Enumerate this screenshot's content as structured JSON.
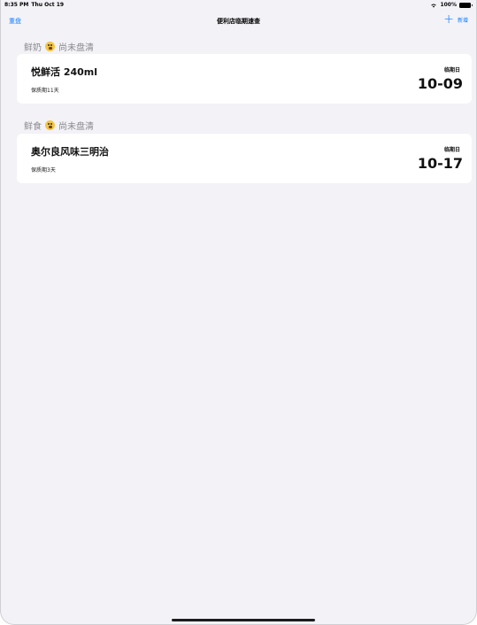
{
  "status_bar": {
    "time": "8:35 PM",
    "date": "Thu Oct 19",
    "battery": "100%"
  },
  "nav": {
    "left_label": "重盘",
    "title": "便利店临期速查",
    "right_label": "新增",
    "right_icon": "plus-icon"
  },
  "sections": [
    {
      "name": "鲜奶",
      "status": "尚未盘清",
      "item": {
        "name": "悦鲜活 240ml",
        "shelf_life": "保质期11天",
        "expiry_label": "临期日",
        "expiry_date": "10-09"
      }
    },
    {
      "name": "鲜食",
      "status": "尚未盘清",
      "item": {
        "name": "奥尔良风味三明治",
        "shelf_life": "保质期3天",
        "expiry_label": "临期日",
        "expiry_date": "10-17"
      }
    }
  ],
  "colors": {
    "accent": "#0a7aff",
    "background": "#f2f2f7",
    "section_text": "#8a8a8e"
  }
}
